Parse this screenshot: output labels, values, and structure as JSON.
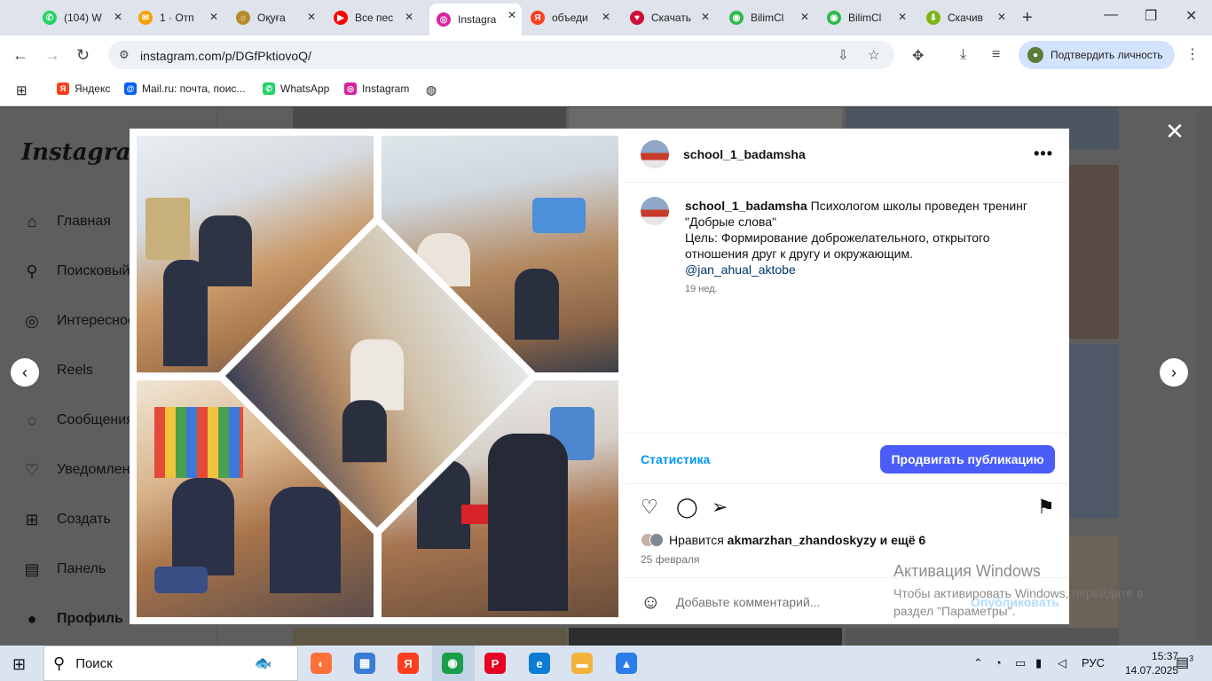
{
  "browser": {
    "tabs": [
      {
        "label": "(104) W",
        "icon": "whatsapp-icon",
        "color": "#25d366",
        "glyph": "✆"
      },
      {
        "label": "1 · Отп",
        "icon": "mail-icon",
        "color": "#f7a000",
        "glyph": "✉"
      },
      {
        "label": "Оқуға",
        "icon": "gov-icon",
        "color": "#b58b2a",
        "glyph": "☼"
      },
      {
        "label": "Все пес",
        "icon": "youtube-icon",
        "color": "#ff0000",
        "glyph": "▶"
      },
      {
        "label": "Instagra",
        "icon": "instagram-icon",
        "color": "#d6249f",
        "glyph": "◎",
        "active": true
      },
      {
        "label": "объеди",
        "icon": "yandex-icon",
        "color": "#fc3f1d",
        "glyph": "Я"
      },
      {
        "label": "Скачать",
        "icon": "heart-icon",
        "color": "#d0103a",
        "glyph": "♥"
      },
      {
        "label": "BilimCl",
        "icon": "bilimclass-icon",
        "color": "#2fb84f",
        "glyph": "◉"
      },
      {
        "label": "BilimCl",
        "icon": "bilimclass-icon",
        "color": "#2fb84f",
        "glyph": "◉"
      },
      {
        "label": "Скачив",
        "icon": "download-green-icon",
        "color": "#7cb518",
        "glyph": "⬇"
      }
    ],
    "url": "instagram.com/p/DGfPktiovoQ/",
    "verify_label": "Подтвердить личность",
    "bookmarks": [
      {
        "label": "Яндекс",
        "icon": "yandex-icon",
        "color": "#fc3f1d",
        "glyph": "Я"
      },
      {
        "label": "Mail.ru: почта, поис...",
        "icon": "mailru-icon",
        "color": "#005ff9",
        "glyph": "@"
      },
      {
        "label": "WhatsApp",
        "icon": "whatsapp-icon",
        "color": "#25d366",
        "glyph": "✆"
      },
      {
        "label": "Instagram",
        "icon": "instagram-icon",
        "color": "#d6249f",
        "glyph": "◎"
      }
    ]
  },
  "instagram": {
    "logo": "Instagram",
    "nav": [
      {
        "label": "Главная",
        "icon": "home-icon",
        "glyph": "⌂"
      },
      {
        "label": "Поисковый",
        "icon": "search-icon",
        "glyph": "⚲"
      },
      {
        "label": "Интересное",
        "icon": "compass-icon",
        "glyph": "◎"
      },
      {
        "label": "Reels",
        "icon": "reels-icon",
        "glyph": "▣"
      },
      {
        "label": "Сообщения",
        "icon": "messenger-icon",
        "glyph": "◌"
      },
      {
        "label": "Уведомлен",
        "icon": "heart-icon",
        "glyph": "♡"
      },
      {
        "label": "Создать",
        "icon": "plus-icon",
        "glyph": "⊞"
      },
      {
        "label": "Панель",
        "icon": "dashboard-icon",
        "glyph": "▤"
      },
      {
        "label": "Профиль",
        "icon": "profile-avatar",
        "glyph": "●"
      }
    ]
  },
  "post": {
    "username": "school_1_badamsha",
    "caption_user": "school_1_badamsha",
    "caption_lines": [
      "Психологом школы проведен тренинг",
      "\"Добрые слова\"",
      "Цель: Формирование доброжелательного, открытого",
      "отношения друг к другу и окружающим."
    ],
    "mention": "@jan_ahual_aktobe",
    "age": "19 нед.",
    "stats_label": "Статистика",
    "promote_label": "Продвигать публикацию",
    "likes_prefix": "Нравится",
    "likes_user": "akmarzhan_zhandoskyzy",
    "likes_suffix": "и ещё 6",
    "date": "25 февраля",
    "comment_placeholder": "Добавьте комментарий...",
    "publish_label": "Опубликовать"
  },
  "watermark": {
    "title": "Активация Windows",
    "text": "Чтобы активировать Windows, перейдите в раздел \"Параметры\"."
  },
  "taskbar": {
    "search_label": "Поиск",
    "lang": "РУС",
    "time": "15:37",
    "date": "14.07.2025",
    "notifications": "3",
    "apps": [
      {
        "icon": "firefox-icon",
        "color": "#ff7139",
        "glyph": "◐"
      },
      {
        "icon": "file-manager-icon",
        "color": "#3a7bd5",
        "glyph": "▦"
      },
      {
        "icon": "yandex-browser-icon",
        "color": "#fc3f1d",
        "glyph": "Я"
      },
      {
        "icon": "chrome-icon",
        "color": "#1a9e4b",
        "glyph": "◉",
        "active": true
      },
      {
        "icon": "pinterest-icon",
        "color": "#e60023",
        "glyph": "P"
      },
      {
        "icon": "edge-icon",
        "color": "#0c7cd5",
        "glyph": "e"
      },
      {
        "icon": "folder-icon",
        "color": "#f2b33d",
        "glyph": "▬"
      },
      {
        "icon": "photos-icon",
        "color": "#2b7de9",
        "glyph": "▲"
      }
    ]
  },
  "colors": {
    "accent": "#4a5df9",
    "link": "#00376b",
    "stats": "#0095f6"
  }
}
